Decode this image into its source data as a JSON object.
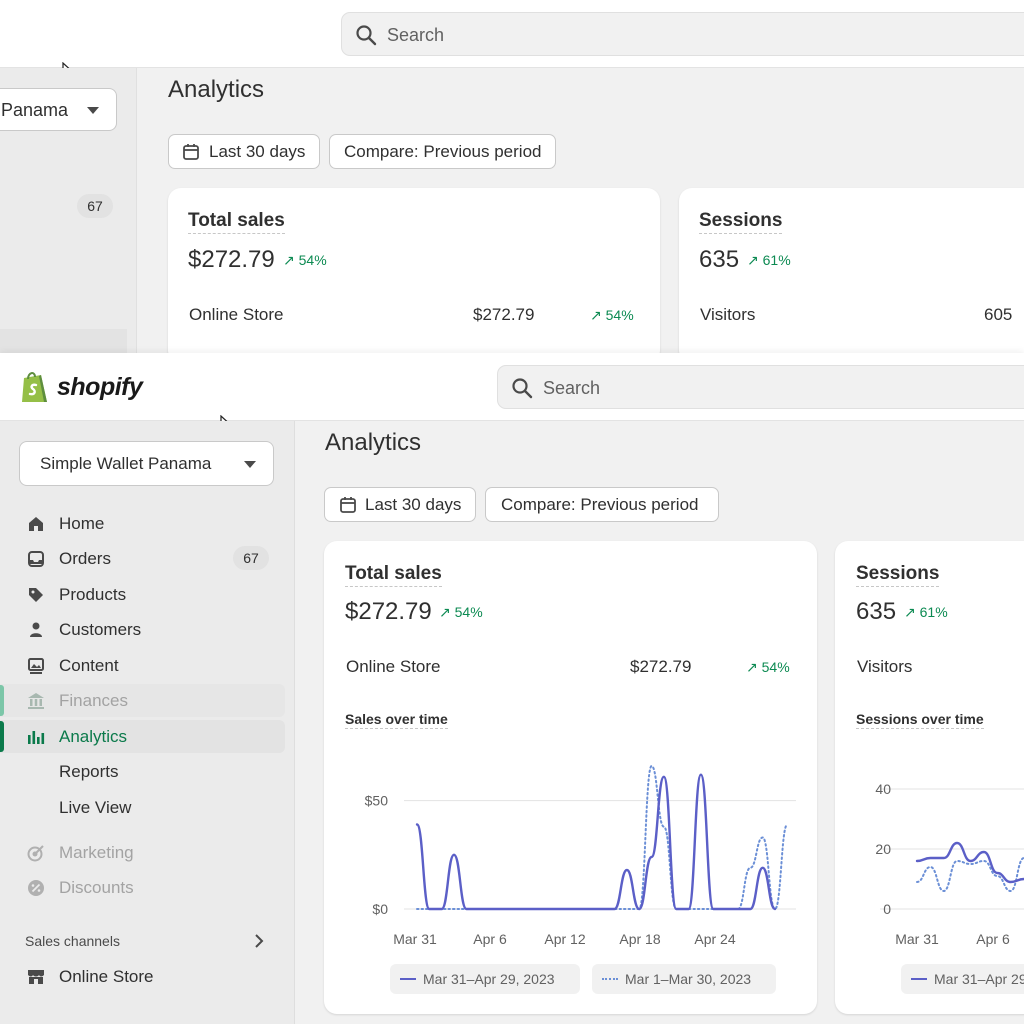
{
  "app": {
    "brand": "shopify",
    "brand_color": "#5e8e3e",
    "accent_green": "#0b7a4b",
    "positive_color": "#0c8a52"
  },
  "search": {
    "placeholder": "Search"
  },
  "store": {
    "name": "Simple Wallet Panama",
    "name_cropped": "Panama"
  },
  "nav": {
    "home": "Home",
    "orders": "Orders",
    "orders_badge": "67",
    "products": "Products",
    "customers": "Customers",
    "content": "Content",
    "finances": "Finances",
    "analytics": "Analytics",
    "reports": "Reports",
    "live_view": "Live View",
    "marketing": "Marketing",
    "discounts": "Discounts",
    "sales_channels": "Sales channels",
    "online_store": "Online Store"
  },
  "page": {
    "title": "Analytics",
    "date_range": "Last 30 days",
    "compare": "Compare: Previous period"
  },
  "sales_card": {
    "title": "Total sales",
    "value": "$272.79",
    "change": "54%",
    "row_label": "Online Store",
    "row_value": "$272.79",
    "row_change": "54%",
    "chart_title": "Sales over time"
  },
  "sessions_card": {
    "title": "Sessions",
    "value": "635",
    "change": "61%",
    "row_label": "Visitors",
    "row_value": "605",
    "chart_title": "Sessions over time"
  },
  "chart_data": [
    {
      "type": "line",
      "title": "Sales over time",
      "x_ticks": [
        "Mar 31",
        "Apr 6",
        "Apr 12",
        "Apr 18",
        "Apr 24"
      ],
      "y_ticks": [
        "$0",
        "$50"
      ],
      "ylim": [
        0,
        60
      ],
      "series": [
        {
          "name": "Mar 31–Apr 29, 2023",
          "style": "solid",
          "color": "#5b5fc7",
          "values": [
            39,
            0,
            0,
            25,
            0,
            0,
            0,
            0,
            0,
            0,
            0,
            0,
            0,
            0,
            0,
            0,
            0,
            18,
            0,
            24,
            61,
            0,
            0,
            62,
            0,
            0,
            0,
            0,
            19,
            0
          ]
        },
        {
          "name": "Mar 1–Mar 30, 2023",
          "style": "dotted",
          "color": "#6b8fd6",
          "values": [
            0,
            0,
            0,
            0,
            0,
            0,
            0,
            0,
            0,
            0,
            0,
            0,
            0,
            0,
            0,
            0,
            0,
            0,
            0,
            66,
            38,
            0,
            0,
            0,
            0,
            0,
            0,
            19,
            33,
            0,
            39
          ]
        }
      ]
    },
    {
      "type": "line",
      "title": "Sessions over time",
      "x_ticks": [
        "Mar 31",
        "Apr 6"
      ],
      "y_ticks": [
        "0",
        "20",
        "40"
      ],
      "ylim": [
        0,
        45
      ],
      "series": [
        {
          "name": "Mar 31–Apr 29, 2023",
          "style": "solid",
          "color": "#5b5fc7",
          "values": [
            16,
            17,
            17,
            22,
            16,
            19,
            12,
            9,
            10
          ]
        },
        {
          "name": "Mar 1–Mar 30, 2023",
          "style": "dotted",
          "color": "#6b8fd6",
          "values": [
            9,
            14,
            6,
            16,
            15,
            16,
            11,
            6,
            17
          ]
        }
      ]
    }
  ]
}
